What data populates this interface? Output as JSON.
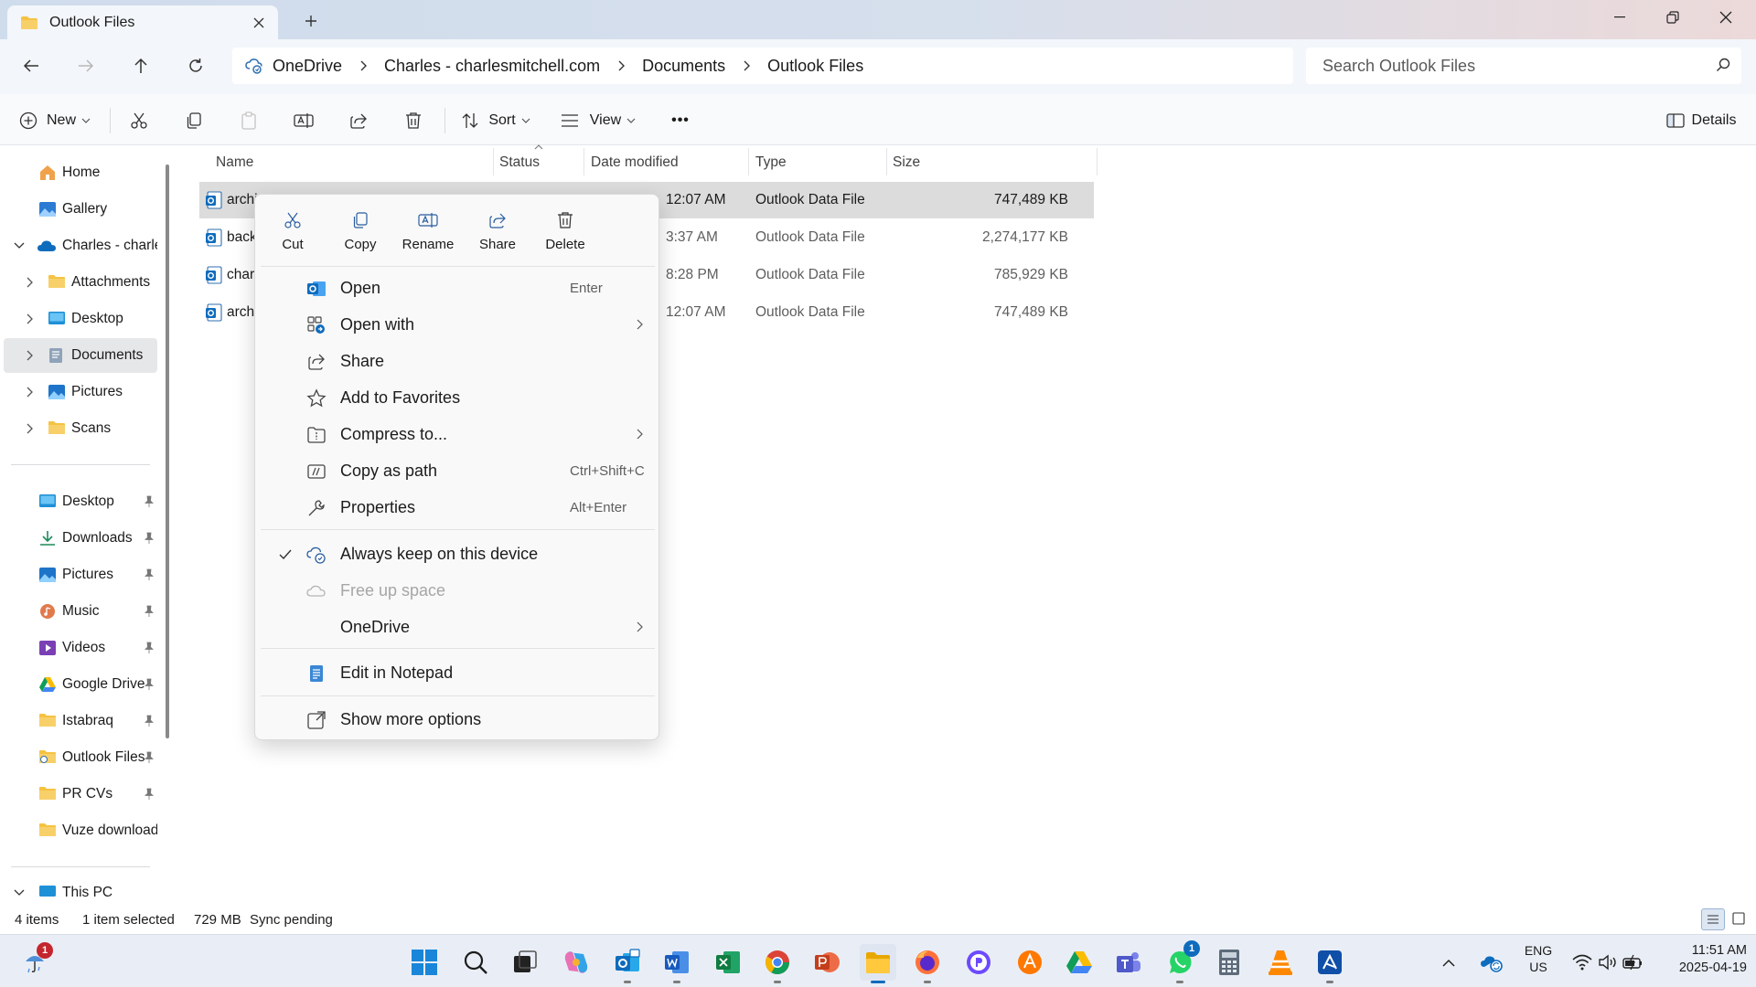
{
  "window": {
    "tab_title": "Outlook Files",
    "new_tab_symbol": "+"
  },
  "nav": {
    "breadcrumbs": [
      "OneDrive",
      "Charles - charlesmitchell.com",
      "Documents",
      "Outlook Files"
    ],
    "search_placeholder": "Search Outlook Files"
  },
  "toolbar": {
    "new_label": "New",
    "sort_label": "Sort",
    "view_label": "View",
    "more_label": "•••",
    "details_label": "Details"
  },
  "sidebar": {
    "items": [
      {
        "label": "Home",
        "icon": "home-icon"
      },
      {
        "label": "Gallery",
        "icon": "gallery-icon"
      },
      {
        "label": "Charles - charles",
        "icon": "onedrive-icon"
      },
      {
        "label": "Attachments",
        "icon": "folder-icon"
      },
      {
        "label": "Desktop",
        "icon": "desktop-icon"
      },
      {
        "label": "Documents",
        "icon": "documents-icon"
      },
      {
        "label": "Pictures",
        "icon": "pictures-icon"
      },
      {
        "label": "Scans",
        "icon": "folder-icon"
      }
    ],
    "quick": [
      {
        "label": "Desktop",
        "icon": "desktop-icon"
      },
      {
        "label": "Downloads",
        "icon": "download-icon"
      },
      {
        "label": "Pictures",
        "icon": "pictures-icon"
      },
      {
        "label": "Music",
        "icon": "music-icon"
      },
      {
        "label": "Videos",
        "icon": "videos-icon"
      },
      {
        "label": "Google Drive",
        "icon": "google-drive-icon"
      },
      {
        "label": "Istabraq",
        "icon": "folder-icon"
      },
      {
        "label": "Outlook Files",
        "icon": "cloud-folder-icon"
      },
      {
        "label": "PR CVs",
        "icon": "folder-icon"
      },
      {
        "label": "Vuze downloads",
        "icon": "folder-icon"
      }
    ],
    "this_pc": "This PC"
  },
  "columns": {
    "name": "Name",
    "status": "Status",
    "date": "Date modified",
    "type": "Type",
    "size": "Size"
  },
  "files": [
    {
      "name": "archi",
      "date": "12:07 AM",
      "type": "Outlook Data File",
      "size": "747,489 KB"
    },
    {
      "name": "back",
      "date": "3:37 AM",
      "type": "Outlook Data File",
      "size": "2,274,177 KB"
    },
    {
      "name": "char",
      "date": "8:28 PM",
      "type": "Outlook Data File",
      "size": "785,929 KB"
    },
    {
      "name": "arch",
      "date": "12:07 AM",
      "type": "Outlook Data File",
      "size": "747,489 KB"
    }
  ],
  "context_menu": {
    "quick_actions": {
      "cut": "Cut",
      "copy": "Copy",
      "rename": "Rename",
      "share": "Share",
      "delete": "Delete"
    },
    "items": {
      "open": "Open",
      "open_key": "Enter",
      "open_with": "Open with",
      "share": "Share",
      "favorites": "Add to Favorites",
      "compress": "Compress to...",
      "copy_path": "Copy as path",
      "copy_path_key": "Ctrl+Shift+C",
      "properties": "Properties",
      "properties_key": "Alt+Enter",
      "always_keep": "Always keep on this device",
      "free_up": "Free up space",
      "onedrive": "OneDrive",
      "notepad": "Edit in Notepad",
      "more_options": "Show more options"
    }
  },
  "status": {
    "count": "4 items",
    "selected": "1 item selected",
    "size": "729 MB",
    "sync": "Sync pending"
  },
  "taskbar": {
    "weather_badge": "1",
    "whatsapp_badge": "1",
    "lang": "ENG",
    "region": "US",
    "time": "11:51 AM",
    "date": "2025-04-19"
  },
  "colors": {
    "accent": "#0f6cbd",
    "folder": "#f5c342",
    "selection": "#dcdcdc"
  }
}
